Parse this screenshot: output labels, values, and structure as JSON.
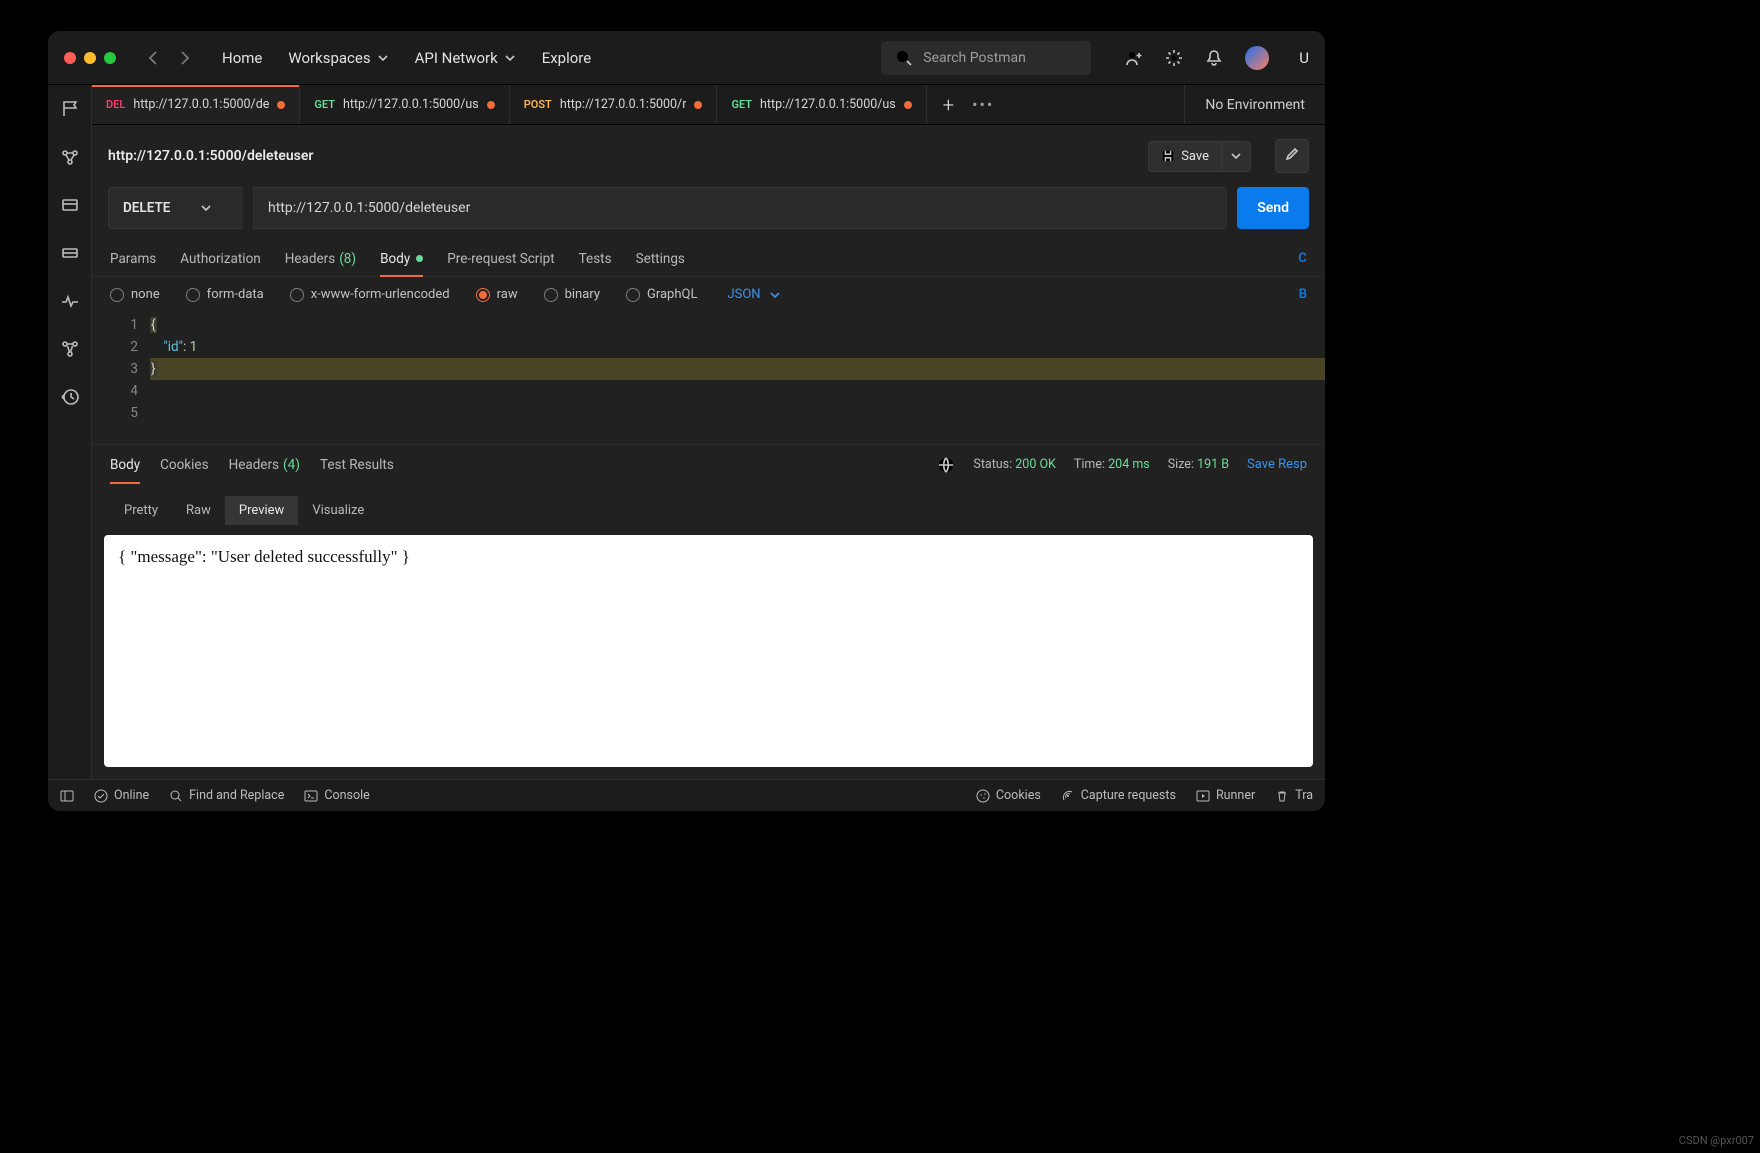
{
  "menu": {
    "home": "Home",
    "workspaces": "Workspaces",
    "api_network": "API Network",
    "explore": "Explore"
  },
  "search_placeholder": "Search Postman",
  "user_initial": "U",
  "tabs": [
    {
      "method": "DEL",
      "mclass": "m-del",
      "label": "http://127.0.0.1:5000/de",
      "dirty": true,
      "active": true
    },
    {
      "method": "GET",
      "mclass": "m-get",
      "label": "http://127.0.0.1:5000/us",
      "dirty": true
    },
    {
      "method": "POST",
      "mclass": "m-post",
      "label": "http://127.0.0.1:5000/r",
      "dirty": true
    },
    {
      "method": "GET",
      "mclass": "m-get",
      "label": "http://127.0.0.1:5000/us",
      "dirty": true
    }
  ],
  "no_environment": "No Environment",
  "request_name": "http://127.0.0.1:5000/deleteuser",
  "save_label": "Save",
  "http_method": "DELETE",
  "url": "http://127.0.0.1:5000/deleteuser",
  "send_label": "Send",
  "req_subtabs": {
    "params": "Params",
    "auth": "Authorization",
    "headers": "Headers",
    "headers_count": "(8)",
    "body": "Body",
    "prereq": "Pre-request Script",
    "tests": "Tests",
    "settings": "Settings",
    "right": "C"
  },
  "body_types": {
    "none": "none",
    "formdata": "form-data",
    "urlenc": "x-www-form-urlencoded",
    "raw": "raw",
    "binary": "binary",
    "graphql": "GraphQL",
    "content_type": "JSON",
    "right": "B"
  },
  "editor": {
    "lines": [
      "1",
      "2",
      "3",
      "4",
      "5"
    ],
    "l1": "{",
    "l2_key": "\"id\"",
    "l2_sep": ": ",
    "l2_val": "1",
    "l3": "}"
  },
  "response": {
    "tabs": {
      "body": "Body",
      "cookies": "Cookies",
      "headers": "Headers",
      "headers_count": "(4)",
      "testresults": "Test Results"
    },
    "status_label": "Status:",
    "status_value": "200 OK",
    "time_label": "Time:",
    "time_value": "204 ms",
    "size_label": "Size:",
    "size_value": "191 B",
    "save": "Save Resp"
  },
  "view": {
    "pretty": "Pretty",
    "raw": "Raw",
    "preview": "Preview",
    "visualize": "Visualize"
  },
  "preview_body": "{ \"message\": \"User deleted successfully\" }",
  "statusbar": {
    "online": "Online",
    "find": "Find and Replace",
    "console": "Console",
    "cookies": "Cookies",
    "capture": "Capture requests",
    "runner": "Runner",
    "trash": "Tra"
  },
  "watermark": "CSDN @pxr007"
}
